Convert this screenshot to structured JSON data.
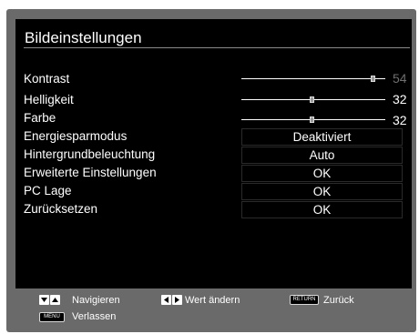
{
  "menu": {
    "title": "Bildeinstellungen",
    "items": [
      {
        "label": "Kontrast",
        "type": "slider",
        "value": "54",
        "level": 0.9,
        "dim": true
      },
      {
        "label": "Helligkeit",
        "type": "slider",
        "value": "32",
        "level": 0.5,
        "dim": false
      },
      {
        "label": "Farbe",
        "type": "slider",
        "value": "32",
        "level": 0.5,
        "dim": false
      },
      {
        "label": "Energiesparmodus",
        "type": "option",
        "value": "Deaktiviert"
      },
      {
        "label": "Hintergrundbeleuchtung",
        "type": "option",
        "value": "Auto"
      },
      {
        "label": "Erweiterte Einstellungen",
        "type": "option",
        "value": "OK"
      },
      {
        "label": "PC Lage",
        "type": "option",
        "value": "OK"
      },
      {
        "label": "Zurücksetzen",
        "type": "option",
        "value": "OK"
      }
    ]
  },
  "footer": {
    "navigate_label": "Navigieren",
    "change_value_label": "Wert ändern",
    "back_key": "RETURN",
    "back_label": "Zurück",
    "menu_key": "MENU",
    "exit_label": "Verlassen"
  },
  "icons": {
    "navigate": "up-down-arrows-icon",
    "change_value": "left-right-arrows-icon",
    "back": "return-key-icon",
    "menu": "menu-key-icon"
  },
  "colors": {
    "panel": "#000000",
    "frame": "#6a6a6a",
    "text": "#ffffff",
    "dim_value": "#6f6f6f"
  }
}
